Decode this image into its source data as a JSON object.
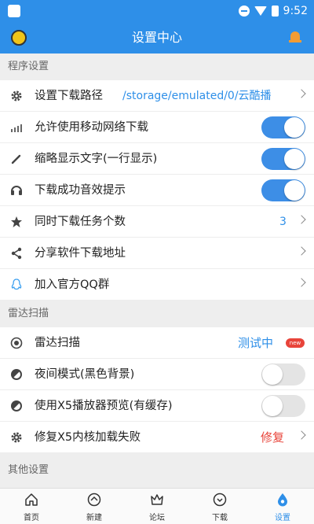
{
  "status_bar": {
    "time": "9:52"
  },
  "header": {
    "title": "设置中心"
  },
  "sections": {
    "program": "程序设置",
    "radar": "雷达扫描",
    "other": "其他设置"
  },
  "rows": {
    "download_path": {
      "label": "设置下载路径",
      "value": "/storage/emulated/0/云酷播"
    },
    "mobile_network": {
      "label": "允许使用移动网络下载",
      "enabled": true
    },
    "abbreviate_text": {
      "label": "缩略显示文字(一行显示)",
      "enabled": true
    },
    "download_sound": {
      "label": "下载成功音效提示",
      "enabled": true
    },
    "concurrent": {
      "label": "同时下载任务个数",
      "value": "3"
    },
    "share": {
      "label": "分享软件下载地址"
    },
    "qq_group": {
      "label": "加入官方QQ群"
    },
    "radar_scan": {
      "label": "雷达扫描",
      "value": "测试中",
      "badge": "new"
    },
    "night_mode": {
      "label": "夜间模式(黑色背景)",
      "enabled": false
    },
    "x5_preview": {
      "label": "使用X5播放器预览(有缓存)",
      "enabled": false
    },
    "x5_repair": {
      "label": "修复X5内核加载失败",
      "value": "修复"
    }
  },
  "tabs": [
    {
      "label": "首页",
      "icon": "home-icon"
    },
    {
      "label": "新建",
      "icon": "new-icon"
    },
    {
      "label": "论坛",
      "icon": "forum-icon"
    },
    {
      "label": "下载",
      "icon": "download-icon"
    },
    {
      "label": "设置",
      "icon": "settings-icon",
      "active": true
    }
  ],
  "colors": {
    "primary": "#2e8fe8",
    "toggle_on": "#3d8ee6",
    "toggle_off": "#e4e4e4",
    "value_blue": "#2e8fe8",
    "value_red": "#e8443a"
  }
}
